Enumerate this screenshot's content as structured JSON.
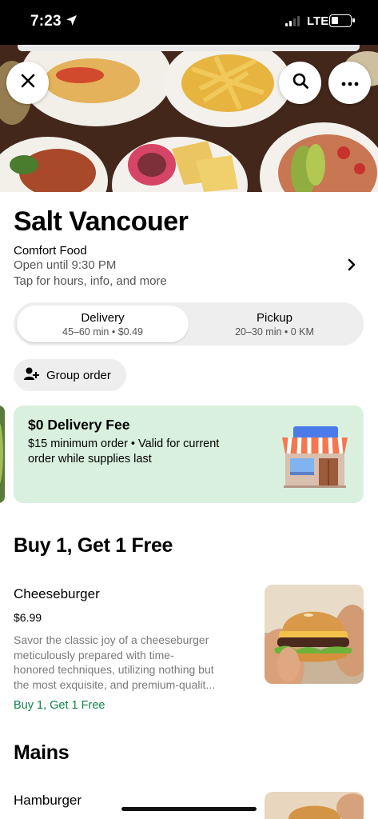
{
  "status_bar": {
    "time": "7:23",
    "network": "LTE",
    "signal_bars": 2,
    "location_icon": "location-arrow-icon",
    "battery_level": 0.25
  },
  "hero": {
    "close_icon": "close-icon",
    "search_icon": "search-icon",
    "more_icon": "more-horizontal-icon"
  },
  "restaurant": {
    "name": "Salt Vancouer",
    "category": "Comfort Food",
    "hours": "Open until 9:30 PM",
    "info_hint": "Tap for hours, info, and more"
  },
  "fulfillment": {
    "selected": "Delivery",
    "delivery": {
      "label": "Delivery",
      "detail": "45–60 min • $0.49"
    },
    "pickup": {
      "label": "Pickup",
      "detail": "20–30 min • 0 KM"
    }
  },
  "group_order": {
    "label": "Group order",
    "icon": "add-person-icon"
  },
  "promo": {
    "title": "$0 Delivery Fee",
    "description_lines": [
      "$15 minimum order • Valid for current",
      "order while supplies last"
    ],
    "icon": "storefront-icon",
    "background": "#d9f0df"
  },
  "sections": {
    "deal_title": "Buy 1, Get 1 Free",
    "mains_title": "Mains"
  },
  "items": [
    {
      "name": "Cheeseburger",
      "price": "$6.99",
      "description_lines": [
        "Savor the classic joy of a cheeseburger",
        "meticulously prepared with time-",
        "honored techniques, utilizing nothing but",
        "the most exquisite, and premium-qualit..."
      ],
      "badge": "Buy 1, Get 1 Free",
      "badge_color": "#0e8345"
    },
    {
      "name": "Hamburger"
    }
  ],
  "colors": {
    "accent_green": "#0e8345",
    "pill_gray": "#eeeeee",
    "secondary_text": "#545454"
  }
}
